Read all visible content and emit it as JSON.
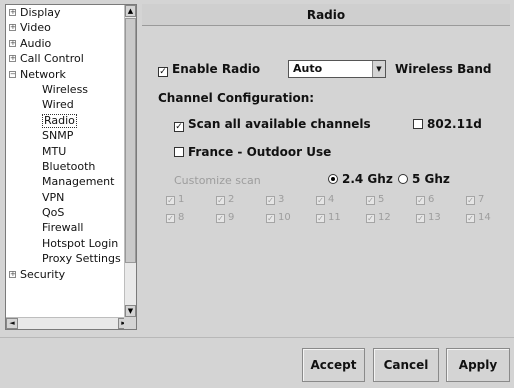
{
  "tree": {
    "items": [
      {
        "label": "Display",
        "expander": "+",
        "child": false
      },
      {
        "label": "Video",
        "expander": "+",
        "child": false
      },
      {
        "label": "Audio",
        "expander": "+",
        "child": false
      },
      {
        "label": "Call Control",
        "expander": "+",
        "child": false
      },
      {
        "label": "Network",
        "expander": "−",
        "child": false
      },
      {
        "label": "Wireless",
        "expander": "",
        "child": true
      },
      {
        "label": "Wired",
        "expander": "",
        "child": true
      },
      {
        "label": "Radio",
        "expander": "",
        "child": true,
        "selected": true
      },
      {
        "label": "SNMP",
        "expander": "",
        "child": true
      },
      {
        "label": "MTU",
        "expander": "",
        "child": true
      },
      {
        "label": "Bluetooth",
        "expander": "",
        "child": true
      },
      {
        "label": "Management",
        "expander": "",
        "child": true
      },
      {
        "label": "VPN",
        "expander": "",
        "child": true
      },
      {
        "label": "QoS",
        "expander": "",
        "child": true
      },
      {
        "label": "Firewall",
        "expander": "",
        "child": true
      },
      {
        "label": "Hotspot Login",
        "expander": "",
        "child": true
      },
      {
        "label": "Proxy Settings",
        "expander": "",
        "child": true
      },
      {
        "label": "Security",
        "expander": "+",
        "child": false
      }
    ]
  },
  "panel": {
    "title": "Radio",
    "enable_radio_label": "Enable Radio",
    "enable_radio_checked": true,
    "band_select_value": "Auto",
    "wireless_band_label": "Wireless Band",
    "channel_config_label": "Channel Configuration:",
    "scan_all_label": "Scan all available channels",
    "scan_all_checked": true,
    "dot11d_label": "802.11d",
    "dot11d_checked": false,
    "france_label": "France - Outdoor Use",
    "france_checked": false,
    "customize_scan_label": "Customize scan",
    "ghz24_label": "2.4 Ghz",
    "ghz24_selected": true,
    "ghz5_label": "5 Ghz",
    "ghz5_selected": false,
    "channels": [
      "1",
      "2",
      "3",
      "4",
      "5",
      "6",
      "7",
      "8",
      "9",
      "10",
      "11",
      "12",
      "13",
      "14"
    ]
  },
  "buttons": {
    "accept": "Accept",
    "cancel": "Cancel",
    "apply": "Apply"
  },
  "glyphs": {
    "check": "✓",
    "up": "▲",
    "down": "▼",
    "left": "◄",
    "right": "►"
  }
}
